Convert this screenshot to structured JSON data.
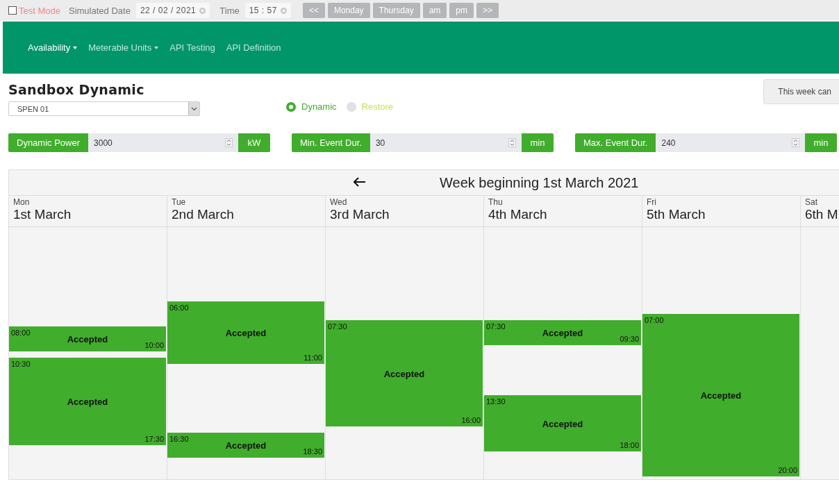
{
  "topbar": {
    "test_mode": {
      "label": "Test Mode",
      "checked": false
    },
    "simulated_date": {
      "label": "Simulated Date",
      "value": "22 / 02 / 2021"
    },
    "time": {
      "label": "Time",
      "value": "15 : 57"
    },
    "buttons": [
      "<<",
      "Monday",
      "Thursday",
      "am",
      "pm",
      ">>"
    ]
  },
  "nav": [
    {
      "label": "Availability",
      "dropdown": true,
      "selected": true
    },
    {
      "label": "Meterable Units",
      "dropdown": true,
      "selected": false
    },
    {
      "label": "API Testing",
      "dropdown": false,
      "selected": false
    },
    {
      "label": "API Definition",
      "dropdown": false,
      "selected": false
    }
  ],
  "title": "Sandbox Dynamic",
  "unit_select": {
    "value": "SPEN 01"
  },
  "mode": [
    {
      "label": "Dynamic",
      "selected": true
    },
    {
      "label": "Restore",
      "selected": false
    }
  ],
  "notice_button": "This week can",
  "inputs": [
    {
      "label": "Dynamic Power",
      "value": "3000",
      "unit": "kW"
    },
    {
      "label": "Min. Event Dur.",
      "value": "30",
      "unit": "min"
    },
    {
      "label": "Max. Event Dur.",
      "value": "240",
      "unit": "min"
    }
  ],
  "calendar": {
    "title": "Week beginning 1st March 2021",
    "days": [
      {
        "weekday": "Mon",
        "date": "1st March",
        "events": [
          {
            "start": "08:00",
            "end": "10:00",
            "status": "Accepted"
          },
          {
            "start": "10:30",
            "end": "17:30",
            "status": "Accepted"
          }
        ]
      },
      {
        "weekday": "Tue",
        "date": "2nd March",
        "events": [
          {
            "start": "06:00",
            "end": "11:00",
            "status": "Accepted"
          },
          {
            "start": "16:30",
            "end": "18:30",
            "status": "Accepted"
          }
        ]
      },
      {
        "weekday": "Wed",
        "date": "3rd March",
        "events": [
          {
            "start": "07:30",
            "end": "16:00",
            "status": "Accepted"
          }
        ]
      },
      {
        "weekday": "Thu",
        "date": "4th March",
        "events": [
          {
            "start": "07:30",
            "end": "09:30",
            "status": "Accepted"
          },
          {
            "start": "13:30",
            "end": "18:00",
            "status": "Accepted"
          }
        ]
      },
      {
        "weekday": "Fri",
        "date": "5th March",
        "events": [
          {
            "start": "07:00",
            "end": "20:00",
            "status": "Accepted"
          }
        ]
      },
      {
        "weekday": "Sat",
        "date": "6th M"
      }
    ]
  }
}
